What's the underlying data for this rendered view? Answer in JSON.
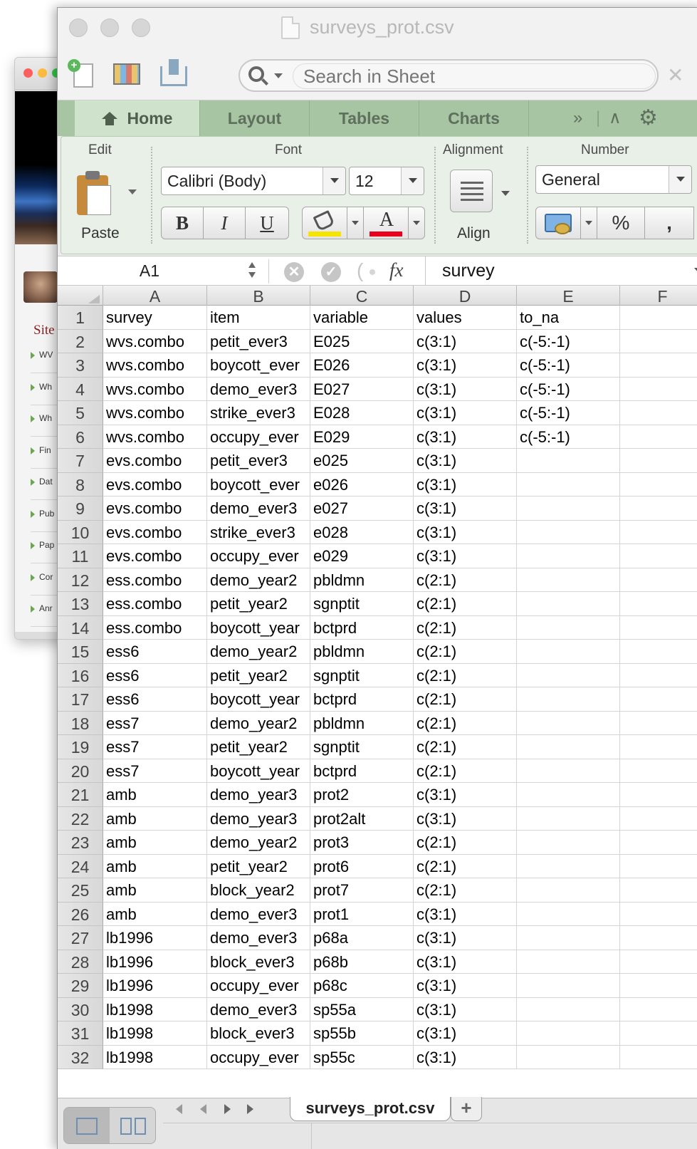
{
  "background_window": {
    "site_label": "Site",
    "items": [
      "WV",
      "Wh",
      "Wh",
      "Fin",
      "Dat",
      "Pub",
      "Pap",
      "Cor",
      "Anr"
    ]
  },
  "window": {
    "title": "surveys_prot.csv"
  },
  "toolbar": {
    "search_placeholder": "Search in Sheet",
    "close_glyph": "✕"
  },
  "ribbon_tabs": [
    "Home",
    "Layout",
    "Tables",
    "Charts"
  ],
  "ribbon_overflow": {
    "more": "»",
    "collapse": "∧",
    "gear": "⚙"
  },
  "ribbon": {
    "edit_label": "Edit",
    "font_label": "Font",
    "alignment_label": "Alignment",
    "number_label": "Number",
    "paste_label": "Paste",
    "font_name": "Calibri (Body)",
    "font_size": "12",
    "bold": "B",
    "italic": "I",
    "underline": "U",
    "font_color_letter": "A",
    "align_label": "Align",
    "number_format": "General",
    "percent": "%",
    "comma": ",",
    "colors": {
      "fill": "#f5e400",
      "font_color": "#e8001c",
      "tab_bar": "#a7c5a3"
    }
  },
  "formula_bar": {
    "name_box": "A1",
    "fx": "fx",
    "content": "survey"
  },
  "columns": [
    "A",
    "B",
    "C",
    "D",
    "E",
    "F"
  ],
  "rows": [
    [
      "1",
      "survey",
      "item",
      "variable",
      "values",
      "to_na"
    ],
    [
      "2",
      "wvs.combo",
      "petit_ever3",
      "E025",
      "c(3:1)",
      "c(-5:-1)"
    ],
    [
      "3",
      "wvs.combo",
      "boycott_ever",
      "E026",
      "c(3:1)",
      "c(-5:-1)"
    ],
    [
      "4",
      "wvs.combo",
      "demo_ever3",
      "E027",
      "c(3:1)",
      "c(-5:-1)"
    ],
    [
      "5",
      "wvs.combo",
      "strike_ever3",
      "E028",
      "c(3:1)",
      "c(-5:-1)"
    ],
    [
      "6",
      "wvs.combo",
      "occupy_ever",
      "E029",
      "c(3:1)",
      "c(-5:-1)"
    ],
    [
      "7",
      "evs.combo",
      "petit_ever3",
      "e025",
      "c(3:1)",
      ""
    ],
    [
      "8",
      "evs.combo",
      "boycott_ever",
      "e026",
      "c(3:1)",
      ""
    ],
    [
      "9",
      "evs.combo",
      "demo_ever3",
      "e027",
      "c(3:1)",
      ""
    ],
    [
      "10",
      "evs.combo",
      "strike_ever3",
      "e028",
      "c(3:1)",
      ""
    ],
    [
      "11",
      "evs.combo",
      "occupy_ever",
      "e029",
      "c(3:1)",
      ""
    ],
    [
      "12",
      "ess.combo",
      "demo_year2",
      "pbldmn",
      "c(2:1)",
      ""
    ],
    [
      "13",
      "ess.combo",
      "petit_year2",
      "sgnptit",
      "c(2:1)",
      ""
    ],
    [
      "14",
      "ess.combo",
      "boycott_year",
      "bctprd",
      "c(2:1)",
      ""
    ],
    [
      "15",
      "ess6",
      "demo_year2",
      "pbldmn",
      "c(2:1)",
      ""
    ],
    [
      "16",
      "ess6",
      "petit_year2",
      "sgnptit",
      "c(2:1)",
      ""
    ],
    [
      "17",
      "ess6",
      "boycott_year",
      "bctprd",
      "c(2:1)",
      ""
    ],
    [
      "18",
      "ess7",
      "demo_year2",
      "pbldmn",
      "c(2:1)",
      ""
    ],
    [
      "19",
      "ess7",
      "petit_year2",
      "sgnptit",
      "c(2:1)",
      ""
    ],
    [
      "20",
      "ess7",
      "boycott_year",
      "bctprd",
      "c(2:1)",
      ""
    ],
    [
      "21",
      "amb",
      "demo_year3",
      "prot2",
      "c(3:1)",
      ""
    ],
    [
      "22",
      "amb",
      "demo_year3",
      "prot2alt",
      "c(3:1)",
      ""
    ],
    [
      "23",
      "amb",
      "demo_year2",
      "prot3",
      "c(2:1)",
      ""
    ],
    [
      "24",
      "amb",
      "petit_year2",
      "prot6",
      "c(2:1)",
      ""
    ],
    [
      "25",
      "amb",
      "block_year2",
      "prot7",
      "c(2:1)",
      ""
    ],
    [
      "26",
      "amb",
      "demo_ever3",
      "prot1",
      "c(3:1)",
      ""
    ],
    [
      "27",
      "lb1996",
      "demo_ever3",
      "p68a",
      "c(3:1)",
      ""
    ],
    [
      "28",
      "lb1996",
      "block_ever3",
      "p68b",
      "c(3:1)",
      ""
    ],
    [
      "29",
      "lb1996",
      "occupy_ever",
      "p68c",
      "c(3:1)",
      ""
    ],
    [
      "30",
      "lb1998",
      "demo_ever3",
      "sp55a",
      "c(3:1)",
      ""
    ],
    [
      "31",
      "lb1998",
      "block_ever3",
      "sp55b",
      "c(3:1)",
      ""
    ],
    [
      "32",
      "lb1998",
      "occupy_ever",
      "sp55c",
      "c(3:1)",
      ""
    ]
  ],
  "sheet_tabs": {
    "active": "surveys_prot.csv",
    "add": "+"
  }
}
